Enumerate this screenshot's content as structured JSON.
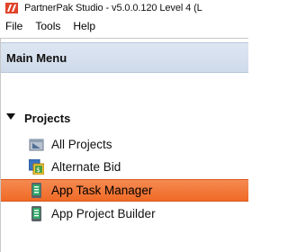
{
  "window": {
    "title": "PartnerPak Studio - v5.0.0.120 Level 4 (L",
    "logo_icon": "partnerpak-logo-icon",
    "logo_color": "#e0442b"
  },
  "menubar": {
    "items": [
      "File",
      "Tools",
      "Help"
    ]
  },
  "panel": {
    "title": "Main Menu"
  },
  "tree": {
    "group": {
      "label": "Projects",
      "expanded": true,
      "expander_icon": "triangle-down-icon"
    },
    "items": [
      {
        "label": "All Projects",
        "icon": "folder-projects-icon",
        "selected": false
      },
      {
        "label": "Alternate Bid",
        "icon": "alternate-bid-icon",
        "selected": false
      },
      {
        "label": "App Task Manager",
        "icon": "mobile-app-icon",
        "selected": true
      },
      {
        "label": "App Project Builder",
        "icon": "mobile-app-icon",
        "selected": false
      }
    ]
  },
  "colors": {
    "selection_bg": "#f06a25",
    "header_bg": "#d6e0ee"
  }
}
